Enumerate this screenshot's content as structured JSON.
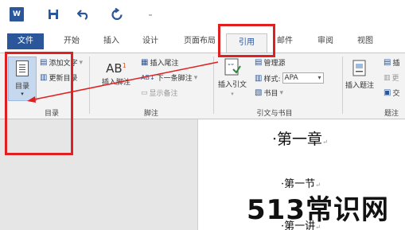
{
  "qat": {
    "app_icon": "W",
    "save_icon": "save-icon",
    "undo_icon": "undo-icon",
    "redo_icon": "redo-icon",
    "customize_glyph": "₌"
  },
  "tabs": [
    {
      "label": "文件"
    },
    {
      "label": "开始"
    },
    {
      "label": "插入"
    },
    {
      "label": "设计"
    },
    {
      "label": "页面布局"
    },
    {
      "label": "引用"
    },
    {
      "label": "邮件"
    },
    {
      "label": "审阅"
    },
    {
      "label": "视图"
    }
  ],
  "ribbon": {
    "toc": {
      "button_label": "目录",
      "add_text": "添加文字",
      "update_toc": "更新目录",
      "group_label": "目录"
    },
    "footnotes": {
      "insert_footnote": "插入脚注",
      "insert_endnote": "插入尾注",
      "next_footnote": "下一条脚注",
      "show_notes": "显示备注",
      "group_label": "脚注",
      "ab_glyph": "AB",
      "ab_sup": "1"
    },
    "citations": {
      "insert_citation": "插入引文",
      "manage_sources": "管理源",
      "style_label": "样式:",
      "style_value": "APA",
      "bibliography": "书目",
      "group_label": "引文与书目"
    },
    "captions": {
      "insert_caption": "插入题注",
      "insert_table_figures": "插",
      "update_table": "更",
      "cross_ref": "交",
      "group_label": "题注"
    }
  },
  "document": {
    "heading1": "第一章",
    "heading2": "第一节",
    "heading3": "第一讲"
  },
  "watermark": "513常识网",
  "colors": {
    "accent": "#2b579a",
    "annotation": "#e02020"
  }
}
